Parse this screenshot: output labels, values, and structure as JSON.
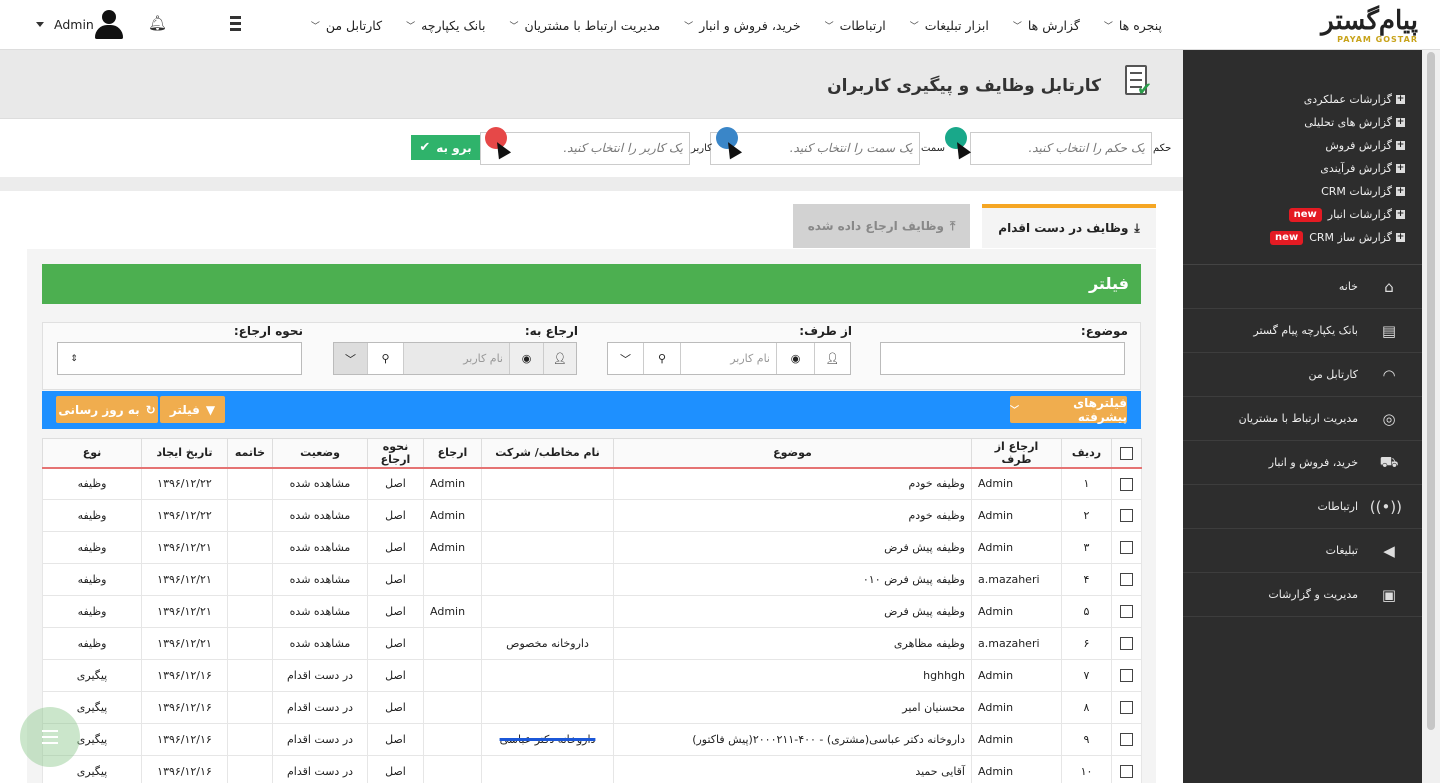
{
  "topbar": {
    "logo_text": "پیام‌گستر",
    "logo_sub": "PAYAM GOSTAR",
    "menu": [
      "کارتابل من",
      "بانک یکپارچه",
      "مدیریت ارتباط با مشتریان",
      "خرید، فروش و انبار",
      "ارتباطات",
      "ابزار تبلیغات",
      "گزارش ها",
      "پنجره ها"
    ],
    "user": "Admin"
  },
  "sidebar": {
    "reports": [
      {
        "label": "گزارشات عملکردی",
        "badge": ""
      },
      {
        "label": "گزارش های تحلیلی",
        "badge": ""
      },
      {
        "label": "گزارش فروش",
        "badge": ""
      },
      {
        "label": "گزارش فرآیندی",
        "badge": ""
      },
      {
        "label": "گزارشات CRM",
        "badge": ""
      },
      {
        "label": "گزارشات انبار",
        "badge": "new"
      },
      {
        "label": "گزارش ساز CRM",
        "badge": "new"
      }
    ],
    "nav": [
      {
        "label": "خانه",
        "icon": "home-icon"
      },
      {
        "label": "بانک یکپارچه پیام گستر",
        "icon": "database-icon"
      },
      {
        "label": "کارتابل من",
        "icon": "dashboard-icon"
      },
      {
        "label": "مدیریت ارتباط با مشتریان",
        "icon": "crm-cycle-icon"
      },
      {
        "label": "خرید، فروش و انبار",
        "icon": "truck-icon"
      },
      {
        "label": "ارتباطات",
        "icon": "broadcast-icon"
      },
      {
        "label": "تبلیغات",
        "icon": "megaphone-icon"
      },
      {
        "label": "مدیریت و گزارشات",
        "icon": "report-icon"
      }
    ]
  },
  "page": {
    "title": "کارتابل وظایف و پیگیری کاربران"
  },
  "selector": {
    "role_label": "حکم",
    "role_placeholder": "یک حکم را انتخاب کنید.",
    "position_label": "سمت",
    "position_placeholder": "یک سمت را انتخاب کنید.",
    "user_label": "کاربر",
    "user_placeholder": "یک کاربر را انتخاب کنید.",
    "go_label": "برو به"
  },
  "tabs": {
    "active": "وظایف در دست اقدام",
    "inactive": "وظایف ارجاع داده شده"
  },
  "filter": {
    "title": "فیلتر",
    "subject_label": "موضوع:",
    "from_label": "از طرف:",
    "to_label": "ارجاع به:",
    "method_label": "نحوه ارجاع:",
    "from_placeholder": "نام کاربر",
    "to_placeholder": "نام کاربر",
    "advanced_label": "فیلترهای پیشرفته",
    "filter_btn": "فیلتر",
    "refresh_btn": "به روز رسانی"
  },
  "table": {
    "columns": [
      "ردیف",
      "ارجاع از طرف",
      "موضوع",
      "نام مخاطب/ شرکت",
      "ارجاع",
      "نحوه ارجاع",
      "وضعیت",
      "خاتمه",
      "تاریخ ایجاد",
      "نوع"
    ],
    "rows": [
      {
        "n": "۱",
        "from": "Admin",
        "subject": "وظیفه خودم",
        "contact": "",
        "ref": "Admin",
        "method": "اصل",
        "status": "مشاهده شده",
        "end": "",
        "date": "۱۳۹۶/۱۲/۲۲",
        "type": "وظیفه"
      },
      {
        "n": "۲",
        "from": "Admin",
        "subject": "وظیفه خودم",
        "contact": "",
        "ref": "Admin",
        "method": "اصل",
        "status": "مشاهده شده",
        "end": "",
        "date": "۱۳۹۶/۱۲/۲۲",
        "type": "وظیفه"
      },
      {
        "n": "۳",
        "from": "Admin",
        "subject": "وظیفه پیش فرض",
        "contact": "",
        "ref": "Admin",
        "method": "اصل",
        "status": "مشاهده شده",
        "end": "",
        "date": "۱۳۹۶/۱۲/۲۱",
        "type": "وظیفه"
      },
      {
        "n": "۴",
        "from": "a.mazaheri",
        "subject": "وظیفه پیش فرض ۰۱۰",
        "contact": "",
        "ref": "",
        "method": "اصل",
        "status": "مشاهده شده",
        "end": "",
        "date": "۱۳۹۶/۱۲/۲۱",
        "type": "وظیفه"
      },
      {
        "n": "۵",
        "from": "Admin",
        "subject": "وظیفه پیش فرض",
        "contact": "",
        "ref": "Admin",
        "method": "اصل",
        "status": "مشاهده شده",
        "end": "",
        "date": "۱۳۹۶/۱۲/۲۱",
        "type": "وظیفه"
      },
      {
        "n": "۶",
        "from": "a.mazaheri",
        "subject": "وظیفه مظاهری",
        "contact": "داروخانه مخصوص",
        "ref": "",
        "method": "اصل",
        "status": "مشاهده شده",
        "end": "",
        "date": "۱۳۹۶/۱۲/۲۱",
        "type": "وظیفه"
      },
      {
        "n": "۷",
        "from": "Admin",
        "subject": "hghhgh",
        "contact": "",
        "ref": "",
        "method": "اصل",
        "status": "در دست اقدام",
        "end": "",
        "date": "۱۳۹۶/۱۲/۱۶",
        "type": "پیگیری"
      },
      {
        "n": "۸",
        "from": "Admin",
        "subject": "محسنیان امیر",
        "contact": "",
        "ref": "",
        "method": "اصل",
        "status": "در دست اقدام",
        "end": "",
        "date": "۱۳۹۶/۱۲/۱۶",
        "type": "پیگیری"
      },
      {
        "n": "۹",
        "from": "Admin",
        "subject": "داروخانه دکتر عباسی(مشتری) - ۴۰۰-۲۰۰۰۲۱۱(پیش فاکتور)",
        "contact": "داروخانه دکتر عباسی",
        "ref": "",
        "method": "اصل",
        "status": "در دست اقدام",
        "end": "",
        "date": "۱۳۹۶/۱۲/۱۶",
        "type": "پیگیری"
      },
      {
        "n": "۱۰",
        "from": "Admin",
        "subject": "آقایی حمید",
        "contact": "",
        "ref": "",
        "method": "اصل",
        "status": "در دست اقدام",
        "end": "",
        "date": "۱۳۹۶/۱۲/۱۶",
        "type": "پیگیری"
      }
    ]
  },
  "colors": {
    "filter_green": "#4caf50",
    "bar_blue": "#1e90ff",
    "btn_orange": "#f0ad4e",
    "tab_accent": "#f5a623",
    "go_green": "#2fb36b",
    "sidebar_bg": "#2d2d2d"
  }
}
